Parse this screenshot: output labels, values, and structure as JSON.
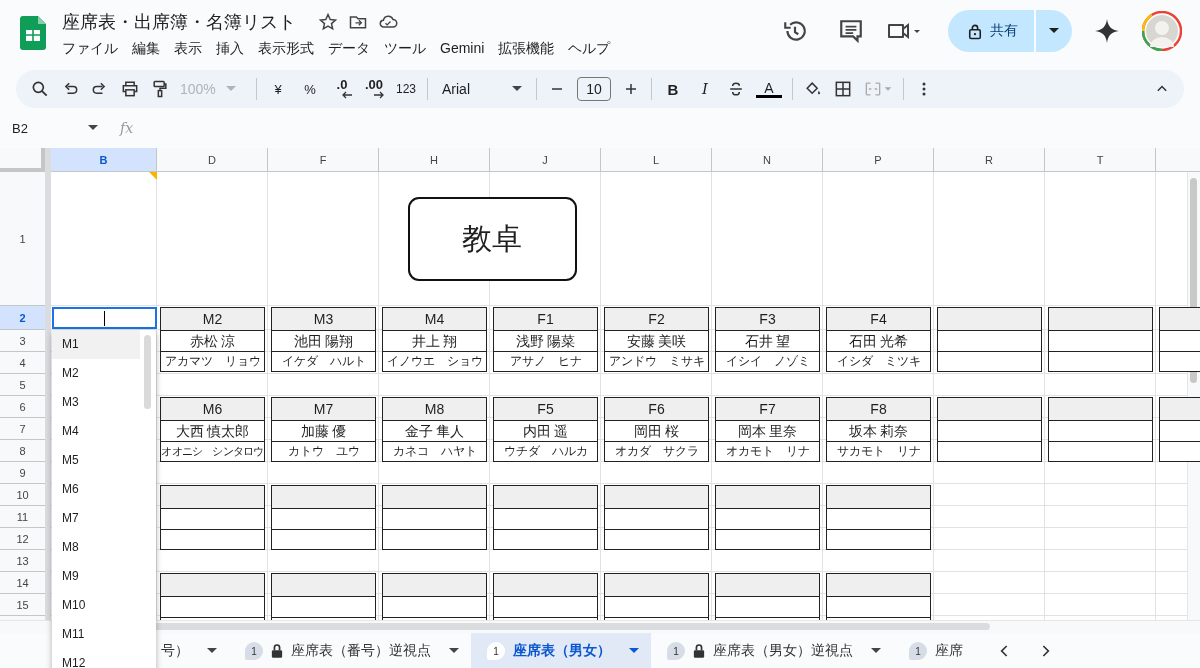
{
  "document": {
    "title": "座席表・出席簿・名簿リスト"
  },
  "menu": [
    "ファイル",
    "編集",
    "表示",
    "挿入",
    "表示形式",
    "データ",
    "ツール",
    "Gemini",
    "拡張機能",
    "ヘルプ"
  ],
  "share_button": {
    "label": "共有"
  },
  "toolbar": {
    "zoom": {
      "value": "100%",
      "disabled": true
    },
    "currency": "¥",
    "percent": "%",
    "decrease_decimals": ".0",
    "increase_decimals": ".00",
    "number_format": "123",
    "font": "Arial",
    "font_size": "10",
    "bold": "B",
    "italic": "I",
    "text_color": "A"
  },
  "name_box": "B2",
  "formula_label": "fx",
  "columns": [
    {
      "label": "B",
      "selected": true
    },
    {
      "label": "D",
      "selected": false
    },
    {
      "label": "F",
      "selected": false
    },
    {
      "label": "H",
      "selected": false
    },
    {
      "label": "J",
      "selected": false
    },
    {
      "label": "L",
      "selected": false
    },
    {
      "label": "N",
      "selected": false
    },
    {
      "label": "P",
      "selected": false
    },
    {
      "label": "R",
      "selected": false
    },
    {
      "label": "T",
      "selected": false
    }
  ],
  "rows": [
    {
      "label": "1",
      "selected": false
    },
    {
      "label": "2",
      "selected": true
    },
    {
      "label": "3",
      "selected": false
    },
    {
      "label": "4",
      "selected": false
    },
    {
      "label": "5",
      "selected": false
    },
    {
      "label": "6",
      "selected": false
    },
    {
      "label": "7",
      "selected": false
    },
    {
      "label": "8",
      "selected": false
    },
    {
      "label": "9",
      "selected": false
    },
    {
      "label": "10",
      "selected": false
    },
    {
      "label": "11",
      "selected": false
    },
    {
      "label": "12",
      "selected": false
    },
    {
      "label": "13",
      "selected": false
    },
    {
      "label": "14",
      "selected": false
    },
    {
      "label": "15",
      "selected": false
    }
  ],
  "teacher_desk": "教卓",
  "seat_groups": [
    {
      "seats": [
        {
          "kind": "filled",
          "number": "M2",
          "name": "赤松 涼",
          "kana": "アカマツ　リョウ"
        },
        {
          "kind": "filled",
          "number": "M3",
          "name": "池田 陽翔",
          "kana": "イケダ　ハルト"
        },
        {
          "kind": "filled",
          "number": "M4",
          "name": "井上 翔",
          "kana": "イノウエ　ショウ"
        },
        {
          "kind": "filled",
          "number": "F1",
          "name": "浅野 陽菜",
          "kana": "アサノ　ヒナ"
        },
        {
          "kind": "filled",
          "number": "F2",
          "name": "安藤 美咲",
          "kana": "アンドウ　ミサキ"
        },
        {
          "kind": "filled",
          "number": "F3",
          "name": "石井 望",
          "kana": "イシイ　ノゾミ"
        },
        {
          "kind": "filled",
          "number": "F4",
          "name": "石田 光希",
          "kana": "イシダ　ミツキ"
        },
        {
          "kind": "empty"
        },
        {
          "kind": "empty"
        },
        {
          "kind": "empty"
        }
      ]
    },
    {
      "seats": [
        {
          "kind": "filled",
          "number": "M6",
          "name": "大西 慎太郎",
          "kana": "オオニシ　シンタロウ"
        },
        {
          "kind": "filled",
          "number": "M7",
          "name": "加藤 優",
          "kana": "カトウ　ユウ"
        },
        {
          "kind": "filled",
          "number": "M8",
          "name": "金子 隼人",
          "kana": "カネコ　ハヤト"
        },
        {
          "kind": "filled",
          "number": "F5",
          "name": "内田 遥",
          "kana": "ウチダ　ハルカ"
        },
        {
          "kind": "filled",
          "number": "F6",
          "name": "岡田 桜",
          "kana": "オカダ　サクラ"
        },
        {
          "kind": "filled",
          "number": "F7",
          "name": "岡本 里奈",
          "kana": "オカモト　リナ"
        },
        {
          "kind": "filled",
          "number": "F8",
          "name": "坂本 莉奈",
          "kana": "サカモト　リナ"
        },
        {
          "kind": "empty"
        },
        {
          "kind": "empty"
        },
        {
          "kind": "empty"
        }
      ]
    },
    {
      "seats": [
        {
          "kind": "empty"
        },
        {
          "kind": "empty"
        },
        {
          "kind": "empty"
        },
        {
          "kind": "empty"
        },
        {
          "kind": "empty"
        },
        {
          "kind": "empty"
        },
        {
          "kind": "empty"
        }
      ]
    },
    {
      "seats": [
        {
          "kind": "empty"
        },
        {
          "kind": "empty"
        },
        {
          "kind": "empty"
        },
        {
          "kind": "empty"
        },
        {
          "kind": "empty"
        },
        {
          "kind": "empty"
        },
        {
          "kind": "empty"
        }
      ]
    }
  ],
  "dropdown": {
    "items": [
      {
        "label": "M1",
        "selected": true
      },
      {
        "label": "M2",
        "selected": false
      },
      {
        "label": "M3",
        "selected": false
      },
      {
        "label": "M4",
        "selected": false
      },
      {
        "label": "M5",
        "selected": false
      },
      {
        "label": "M6",
        "selected": false
      },
      {
        "label": "M7",
        "selected": false
      },
      {
        "label": "M8",
        "selected": false
      },
      {
        "label": "M9",
        "selected": false
      },
      {
        "label": "M10",
        "selected": false
      },
      {
        "label": "M11",
        "selected": false
      },
      {
        "label": "M12",
        "selected": false
      }
    ]
  },
  "sheet_tabs": [
    {
      "label": "号）",
      "locked": false,
      "selected": false,
      "caret": true
    },
    {
      "badge": "1",
      "label": "座席表（番号）逆視点",
      "locked": true,
      "selected": false,
      "caret": true
    },
    {
      "badge": "1",
      "label": "座席表（男女）",
      "locked": false,
      "selected": true,
      "caret": true
    },
    {
      "badge": "1",
      "label": "座席表（男女）逆視点",
      "locked": true,
      "selected": false,
      "caret": true
    },
    {
      "badge": "1",
      "label": "座席",
      "locked": false,
      "selected": false,
      "caret": false
    }
  ]
}
